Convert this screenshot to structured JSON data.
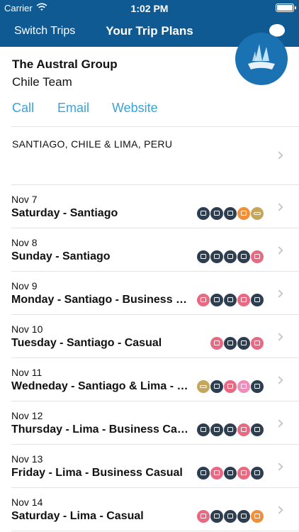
{
  "status_bar": {
    "carrier": "Carrier",
    "time": "1:02 PM"
  },
  "nav": {
    "left_button": "Switch Trips",
    "title": "Your Trip Plans",
    "right_icon": "chat-bubble-icon"
  },
  "header": {
    "organization": "The Austral Group",
    "team": "Chile Team",
    "links": [
      "Call",
      "Email",
      "Website"
    ],
    "logo_icon": "ship-logo-icon"
  },
  "destination": "SANTIAGO, CHILE & LIMA, PERU",
  "colors": {
    "nav_bg": "#0f5a93",
    "link": "#3aa3d8",
    "icon_dark": "#2d3e50",
    "icon_pink": "#e86a82",
    "icon_orange": "#f0903a",
    "icon_gold": "#c6a65d",
    "icon_light_pink": "#ee8fbb"
  },
  "days": [
    {
      "date": "Nov 7",
      "title": "Saturday - Santiago",
      "icons": [
        "dark-calendar-icon",
        "dark-calendar-icon",
        "dark-calendar-icon",
        "orange-hotel-icon",
        "gold-flight-icon"
      ]
    },
    {
      "date": "Nov 8",
      "title": "Sunday - Santiago",
      "icons": [
        "dark-calendar-icon",
        "dark-calendar-icon",
        "dark-calendar-icon",
        "dark-calendar-icon",
        "pink-hotel-icon"
      ]
    },
    {
      "date": "Nov 9",
      "title": "Monday - Santiago - Business Casual",
      "icons": [
        "pink-hotel-icon",
        "dark-calendar-icon",
        "dark-calendar-icon",
        "pink-hotel-icon",
        "dark-calendar-icon"
      ]
    },
    {
      "date": "Nov 10",
      "title": "Tuesday - Santiago - Casual",
      "icons": [
        "pink-hotel-icon",
        "dark-calendar-icon",
        "dark-calendar-icon",
        "pink-hotel-icon"
      ]
    },
    {
      "date": "Nov 11",
      "title": "Wedneday - Santiago & Lima - Casual",
      "icons": [
        "gold-flight-icon",
        "dark-calendar-icon",
        "pink-hotel-icon",
        "light-pink-bus-icon",
        "dark-calendar-icon"
      ]
    },
    {
      "date": "Nov 12",
      "title": "Thursday - Lima - Business Casual",
      "icons": [
        "dark-calendar-icon",
        "dark-calendar-icon",
        "dark-calendar-icon",
        "pink-hotel-icon",
        "dark-calendar-icon"
      ]
    },
    {
      "date": "Nov 13",
      "title": "Friday - Lima - Business Casual",
      "icons": [
        "dark-calendar-icon",
        "pink-hotel-icon",
        "dark-calendar-icon",
        "pink-hotel-icon",
        "dark-calendar-icon"
      ]
    },
    {
      "date": "Nov 14",
      "title": "Saturday - Lima - Casual",
      "icons": [
        "pink-hotel-icon",
        "dark-calendar-icon",
        "dark-calendar-icon",
        "dark-calendar-icon",
        "orange-hotel-icon"
      ]
    }
  ]
}
